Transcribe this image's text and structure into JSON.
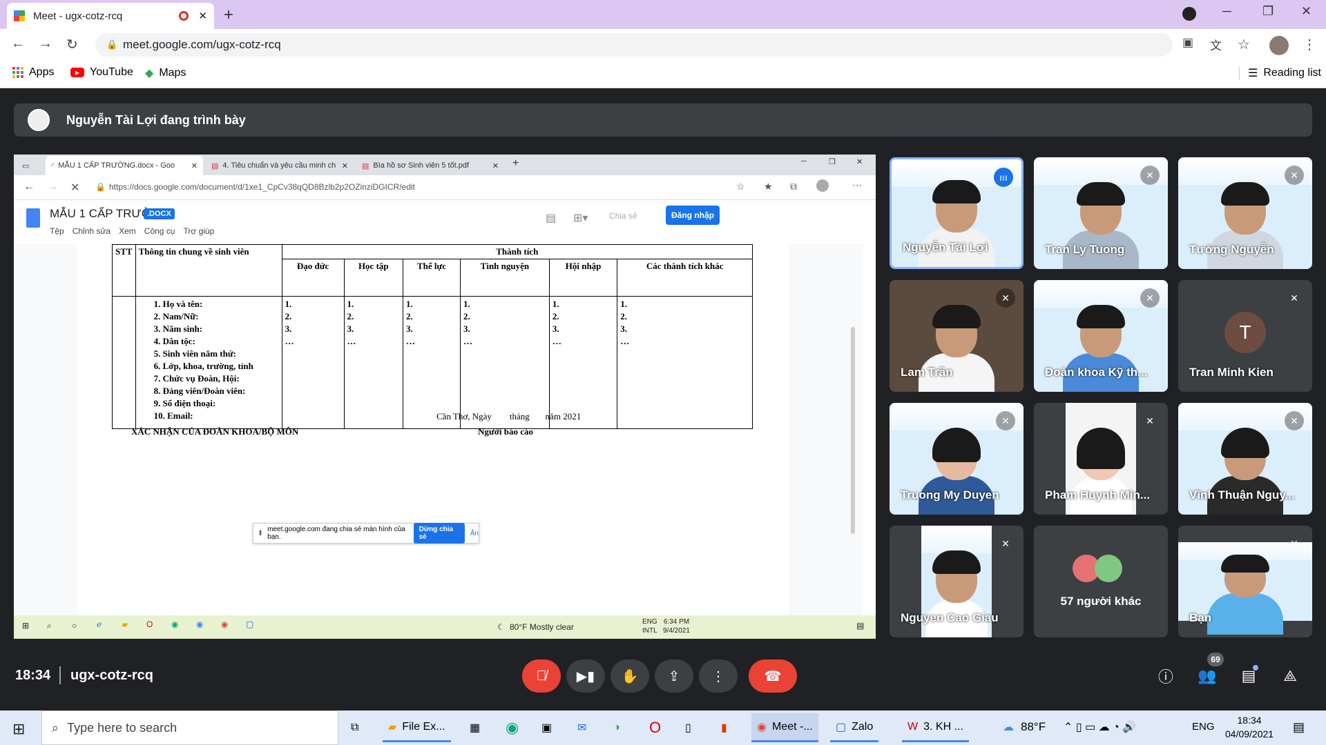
{
  "browser": {
    "tab_title": "Meet - ugx-cotz-rcq",
    "url": "meet.google.com/ugx-cotz-rcq",
    "bookmarks": [
      {
        "label": "Apps"
      },
      {
        "label": "YouTube"
      },
      {
        "label": "Maps"
      }
    ],
    "reading_list": "Reading list"
  },
  "meet": {
    "presenter_banner": "Nguyễn Tài Lợi đang trình bày",
    "time": "18:34",
    "meeting_code": "ugx-cotz-rcq",
    "participants_count": "69",
    "participants": [
      {
        "name": "Nguyễn Tài Lợi",
        "speaking": true
      },
      {
        "name": "Tran Ly Tuong",
        "muted": true
      },
      {
        "name": "Tường Nguyễn",
        "muted": true
      },
      {
        "name": "Lam Trần",
        "muted": true
      },
      {
        "name": "Đoàn khoa Kỹ th...",
        "muted": true
      },
      {
        "name": "Tran Minh Kien",
        "initial": "T",
        "muted": true
      },
      {
        "name": "Truong My Duyen",
        "muted": true
      },
      {
        "name": "Pham Huynh Min...",
        "muted": true
      },
      {
        "name": "Vĩnh Thuận Nguy...",
        "muted": true
      },
      {
        "name": "Nguyen Cao Giau",
        "muted": true
      },
      {
        "name": "57 người khác"
      },
      {
        "name": "Bạn",
        "muted": true
      }
    ]
  },
  "shared": {
    "tabs": [
      {
        "title": "MẪU 1 CẤP TRƯỜNG.docx - Goo"
      },
      {
        "title": "4. Tiêu chuẩn và yêu cầu minh ch"
      },
      {
        "title": "Bìa hồ sơ Sinh viên 5 tốt.pdf"
      }
    ],
    "url": "https://docs.google.com/document/d/1xe1_CpCv38qQD8Bzlb2p2OZinziDGICR/edit",
    "doc_title": "MẪU 1 CẤP TRƯỜNG",
    "doc_badge": ".DOCX",
    "menu": [
      "Tệp",
      "Chỉnh sửa",
      "Xem",
      "Công cụ",
      "Trợ giúp"
    ],
    "share_label": "Chia sẻ",
    "login_label": "Đăng nhập",
    "table": {
      "stt": "STT",
      "info_header": "Thông tin chung về sinh viên",
      "achievements_header": "Thành tích",
      "columns": [
        "Đạo đức",
        "Học tập",
        "Thể lực",
        "Tình nguyện",
        "Hội nhập",
        "Các thành tích khác"
      ],
      "info_items": [
        "1.  Họ và tên:",
        "2.  Nam/Nữ:",
        "3.  Năm sinh:",
        "4.  Dân tộc:",
        "5.  Sinh viên năm thứ:",
        "6.  Lớp, khoa, trường, tỉnh",
        "7.  Chức vụ Đoàn, Hội:",
        "8.  Đảng viên/Đoàn viên:",
        "9.  Số điện thoại:",
        "10. Email:"
      ],
      "cell_items": [
        "1.",
        "2.",
        "3.",
        "…"
      ]
    },
    "place_date": "Cần Thơ, Ngày        tháng       năm 2021",
    "confirm_label": "XÁC NHẬN CỦA ĐOÀN KHOA/BỘ MÔN",
    "reporter_label": "Người báo cáo",
    "share_notice": "meet.google.com đang chia sẻ màn hình của bạn.",
    "stop_share": "Dừng chia sẻ",
    "hide": "Ẩn",
    "taskbar": {
      "weather": "80°F  Mostly clear",
      "lang": "ENG\nINTL",
      "time": "6:34 PM",
      "date": "9/4/2021"
    }
  },
  "windows": {
    "search_placeholder": "Type here to search",
    "apps": [
      {
        "label": "File Ex..."
      },
      {
        "label": "Meet -..."
      },
      {
        "label": "Zalo"
      },
      {
        "label": "3. KH ..."
      }
    ],
    "weather": "88°F",
    "lang": "ENG",
    "time": "18:34",
    "date": "04/09/2021"
  }
}
